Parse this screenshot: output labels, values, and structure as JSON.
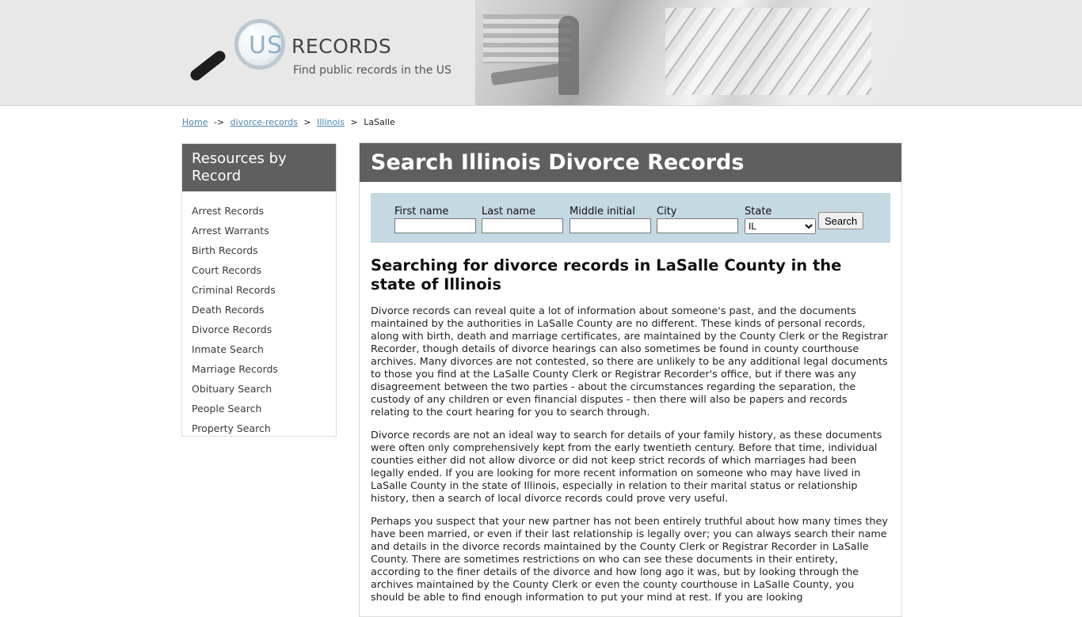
{
  "header": {
    "logo_us": "US",
    "logo_records": "RECORDS",
    "tagline": "Find public records in the US"
  },
  "breadcrumb": {
    "home": "Home",
    "sep1": "->",
    "divorce": "divorce-records",
    "sep2": ">",
    "state": "Illinois",
    "sep3": ">",
    "current": "LaSalle"
  },
  "sidebar": {
    "title": "Resources by Record",
    "items": [
      {
        "label": "Arrest Records"
      },
      {
        "label": "Arrest Warrants"
      },
      {
        "label": "Birth Records"
      },
      {
        "label": "Court Records"
      },
      {
        "label": "Criminal Records"
      },
      {
        "label": "Death Records"
      },
      {
        "label": "Divorce Records"
      },
      {
        "label": "Inmate Search"
      },
      {
        "label": "Marriage Records"
      },
      {
        "label": "Obituary Search"
      },
      {
        "label": "People Search"
      },
      {
        "label": "Property Search"
      }
    ]
  },
  "main": {
    "title": "Search Illinois Divorce Records",
    "search": {
      "first_name_label": "First name",
      "last_name_label": "Last name",
      "middle_initial_label": "Middle initial",
      "city_label": "City",
      "state_label": "State",
      "state_value": "IL",
      "button": "Search"
    },
    "heading": "Searching for divorce records in LaSalle County in the state of Illinois",
    "paragraphs": [
      "Divorce records can reveal quite a lot of information about someone's past, and the documents maintained by the authorities in LaSalle County are no different. These kinds of personal records, along with birth, death and marriage certificates, are maintained by the County Clerk or the Registrar Recorder, though details of divorce hearings can also sometimes be found in county courthouse archives. Many divorces are not contested, so there are unlikely to be any additional legal documents to those you find at the LaSalle County Clerk or Registrar Recorder's office, but if there was any disagreement between the two parties - about the circumstances regarding the separation, the custody of any children or even financial disputes - then there will also be papers and records relating to the court hearing for you to search through.",
      "Divorce records are not an ideal way to search for details of your family history, as these documents were often only comprehensively kept from the early twentieth century. Before that time, individual counties either did not allow divorce or did not keep strict records of which marriages had been legally ended. If you are looking for more recent information on someone who may have lived in LaSalle County in the state of Illinois, especially in relation to their marital status or relationship history, then a search of local divorce records could prove very useful.",
      "Perhaps you suspect that your new partner has not been entirely truthful about how many times they have been married, or even if their last relationship is legally over; you can always search their name and details in the divorce records maintained by the County Clerk or Registrar Recorder in LaSalle County. There are sometimes restrictions on who can see these documents in their entirety, according to the finer details of the divorce and how long ago it was, but by looking through the archives maintained by the County Clerk or even the county courthouse in LaSalle County, you should be able to find enough information to put your mind at rest. If you are looking"
    ]
  }
}
